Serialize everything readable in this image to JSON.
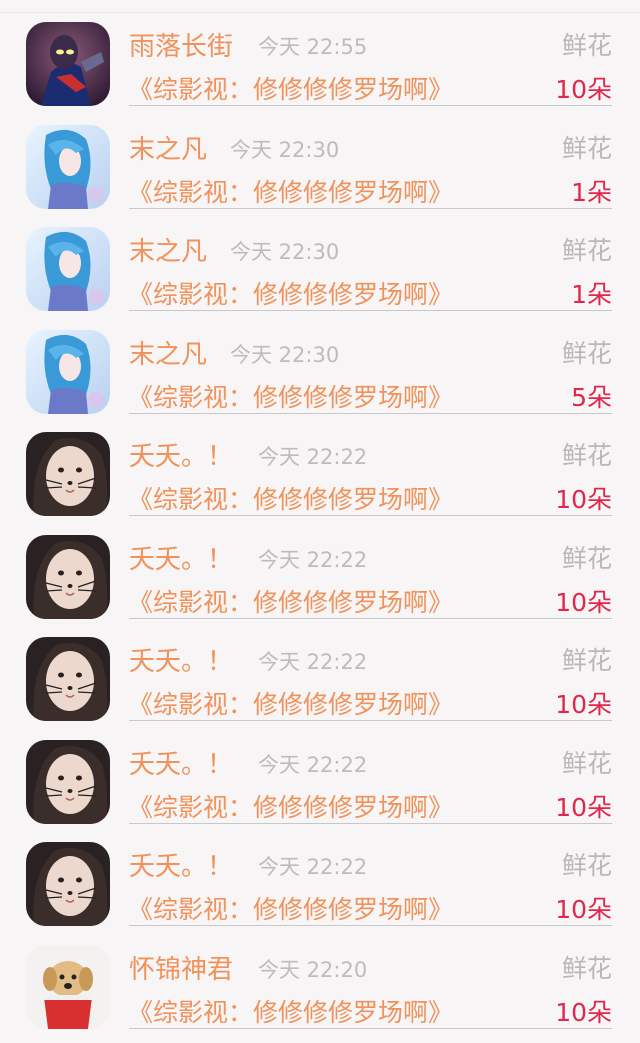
{
  "gift_records": [
    {
      "avatar": "ultraman-avatar",
      "name": "雨落长街",
      "time": "今天 22:55",
      "gift_type": "鲜花",
      "book": "《综影视：修修修修罗场啊》",
      "count": "10朵"
    },
    {
      "avatar": "anime-girl-blue-avatar",
      "name": "末之凡",
      "time": "今天 22:30",
      "gift_type": "鲜花",
      "book": "《综影视：修修修修罗场啊》",
      "count": "1朵"
    },
    {
      "avatar": "anime-girl-blue-avatar",
      "name": "末之凡",
      "time": "今天 22:30",
      "gift_type": "鲜花",
      "book": "《综影视：修修修修罗场啊》",
      "count": "1朵"
    },
    {
      "avatar": "anime-girl-blue-avatar",
      "name": "末之凡",
      "time": "今天 22:30",
      "gift_type": "鲜花",
      "book": "《综影视：修修修修罗场啊》",
      "count": "5朵"
    },
    {
      "avatar": "girl-cat-whiskers-avatar",
      "name": "夭夭。！",
      "time": "今天 22:22",
      "gift_type": "鲜花",
      "book": "《综影视：修修修修罗场啊》",
      "count": "10朵"
    },
    {
      "avatar": "girl-cat-whiskers-avatar",
      "name": "夭夭。！",
      "time": "今天 22:22",
      "gift_type": "鲜花",
      "book": "《综影视：修修修修罗场啊》",
      "count": "10朵"
    },
    {
      "avatar": "girl-cat-whiskers-avatar",
      "name": "夭夭。！",
      "time": "今天 22:22",
      "gift_type": "鲜花",
      "book": "《综影视：修修修修罗场啊》",
      "count": "10朵"
    },
    {
      "avatar": "girl-cat-whiskers-avatar",
      "name": "夭夭。！",
      "time": "今天 22:22",
      "gift_type": "鲜花",
      "book": "《综影视：修修修修罗场啊》",
      "count": "10朵"
    },
    {
      "avatar": "girl-cat-whiskers-avatar",
      "name": "夭夭。！",
      "time": "今天 22:22",
      "gift_type": "鲜花",
      "book": "《综影视：修修修修罗场啊》",
      "count": "10朵"
    },
    {
      "avatar": "puppy-in-cup-avatar",
      "name": "怀锦神君",
      "time": "今天 22:20",
      "gift_type": "鲜花",
      "book": "《综影视：修修修修罗场啊》",
      "count": "10朵"
    }
  ],
  "colors": {
    "name": "#f0925a",
    "book": "#f0925a",
    "count": "#e0284c",
    "muted": "#bdbbbd",
    "background": "#f7f5f6"
  }
}
